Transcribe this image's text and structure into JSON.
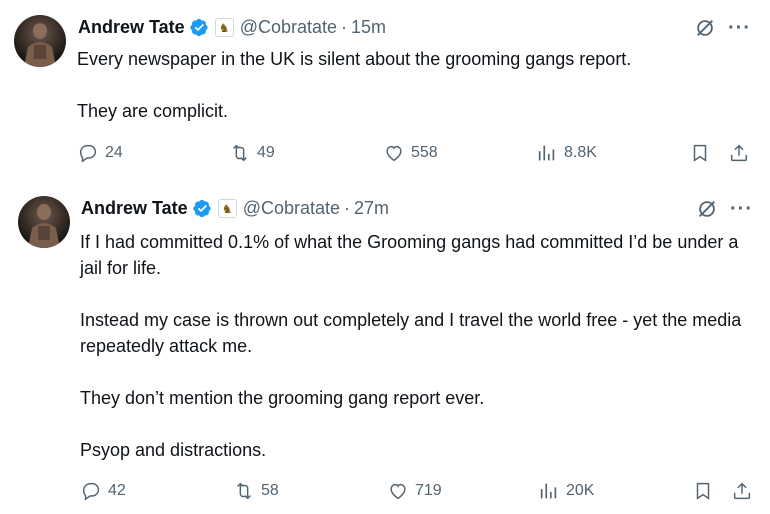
{
  "tweets": [
    {
      "author": "Andrew Tate",
      "handle": "@Cobratate",
      "separator": "·",
      "time": "15m",
      "paragraphs": [
        "Every newspaper in the UK is silent about the grooming gangs report.",
        "They are complicit."
      ],
      "stats": {
        "replies": "24",
        "reposts": "49",
        "likes": "558",
        "views": "8.8K"
      }
    },
    {
      "author": "Andrew Tate",
      "handle": "@Cobratate",
      "separator": "·",
      "time": "27m",
      "paragraphs": [
        "If I had committed 0.1% of what the Grooming gangs had committed I’d be under a jail for life.",
        "Instead my case is thrown out completely and I travel the world free - yet the media repeatedly attack me.",
        "They don’t mention the grooming gang report ever.",
        "Psyop and distractions."
      ],
      "stats": {
        "replies": "42",
        "reposts": "58",
        "likes": "719",
        "views": "20K"
      }
    }
  ],
  "icons": {
    "verified": "verified-badge-icon",
    "affiliate": "chess-knight-badge-icon",
    "grok": "grok-icon",
    "more": "more-icon",
    "reply": "reply-icon",
    "repost": "repost-icon",
    "like": "heart-icon",
    "views": "views-icon",
    "bookmark": "bookmark-icon",
    "share": "share-icon"
  },
  "colors": {
    "verified": "#1d9bf0",
    "secondary_text": "#536471",
    "primary_text": "#0f1419"
  }
}
